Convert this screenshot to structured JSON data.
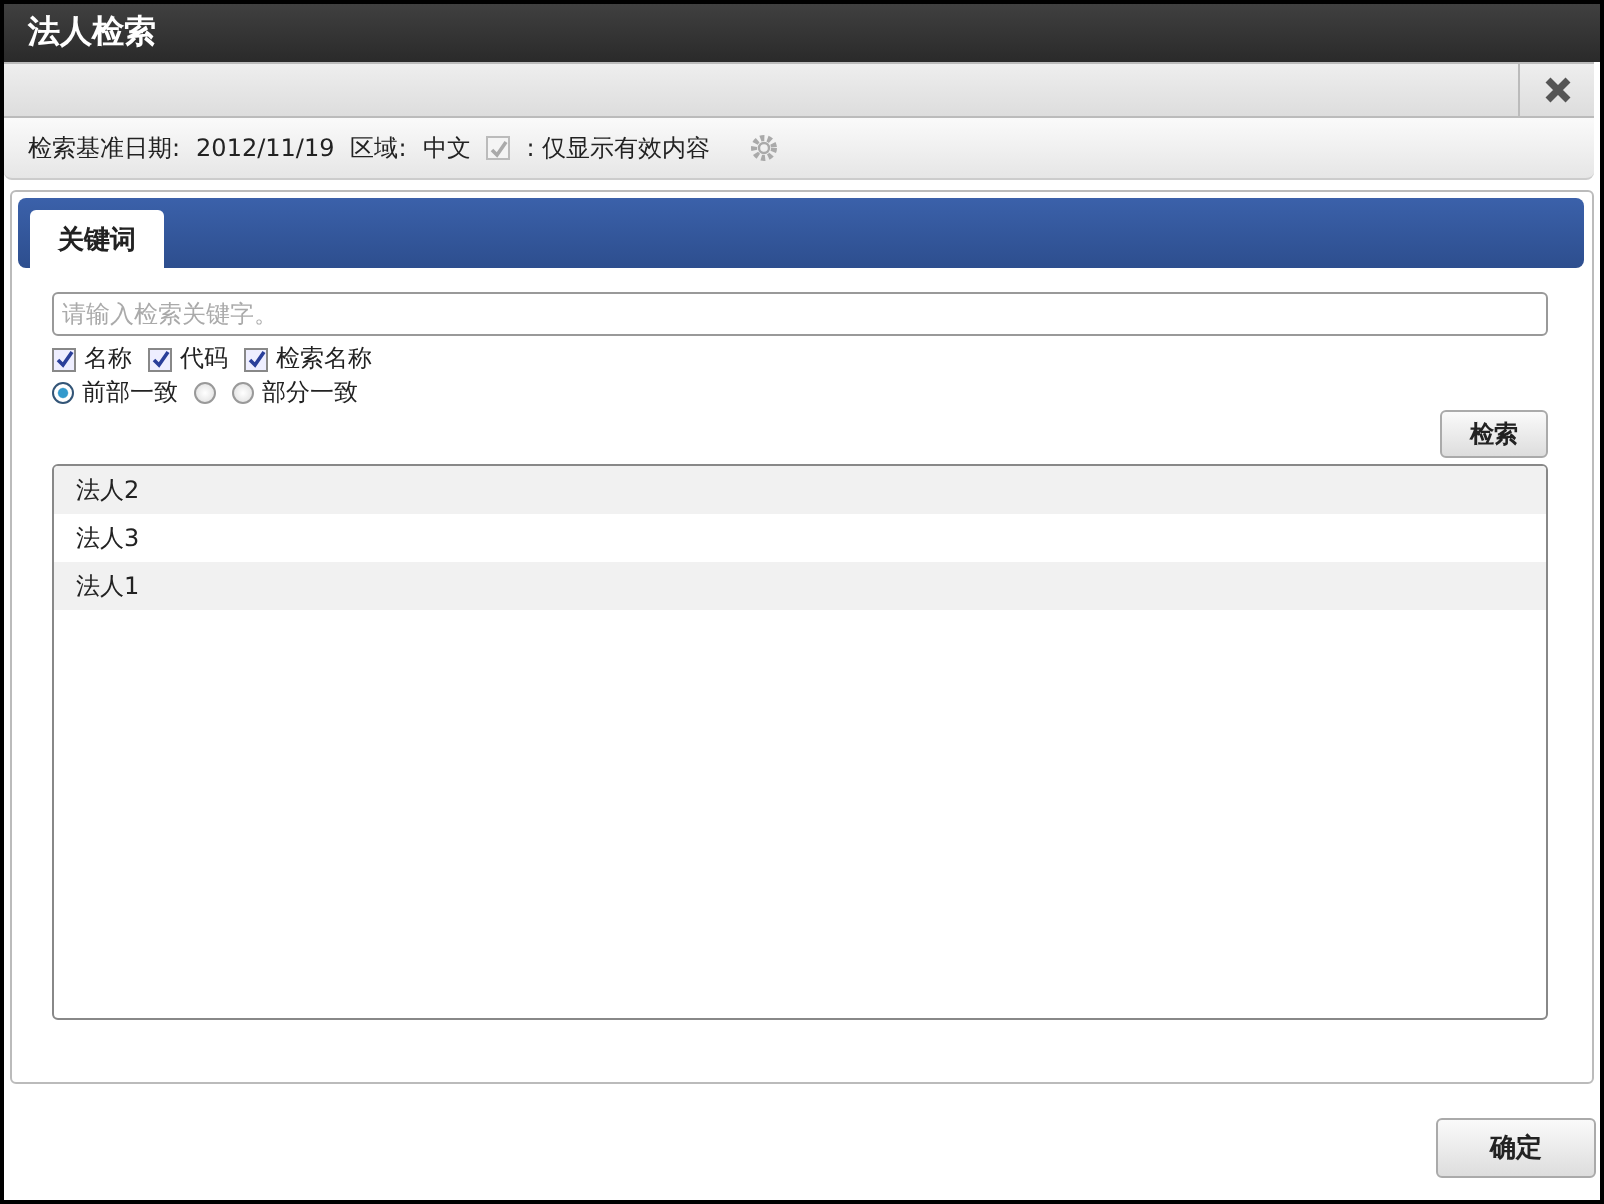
{
  "window": {
    "title": "法人检索"
  },
  "info_bar": {
    "date_label": "检索基准日期:",
    "date": "2012/11/19",
    "region_label": "区域:",
    "region": "中文",
    "valid_only": {
      "label": ": 仅显示有效内容",
      "checked": true,
      "disabled": true
    }
  },
  "tabs": [
    {
      "label": "关键词",
      "selected": true
    }
  ],
  "search": {
    "placeholder": "请输入检索关键字。"
  },
  "fields": [
    {
      "label": "名称",
      "checked": true
    },
    {
      "label": "代码",
      "checked": true
    },
    {
      "label": "检索名称",
      "checked": true
    }
  ],
  "match_modes": [
    {
      "label": "前部一致",
      "selected": true
    },
    {
      "selected": false
    },
    {
      "label": "部分一致",
      "selected": false
    }
  ],
  "search_button": "检索",
  "results": [
    {
      "name": "法人2"
    },
    {
      "name": "法人3"
    },
    {
      "name": "法人1"
    }
  ],
  "ok_button": "确定"
}
